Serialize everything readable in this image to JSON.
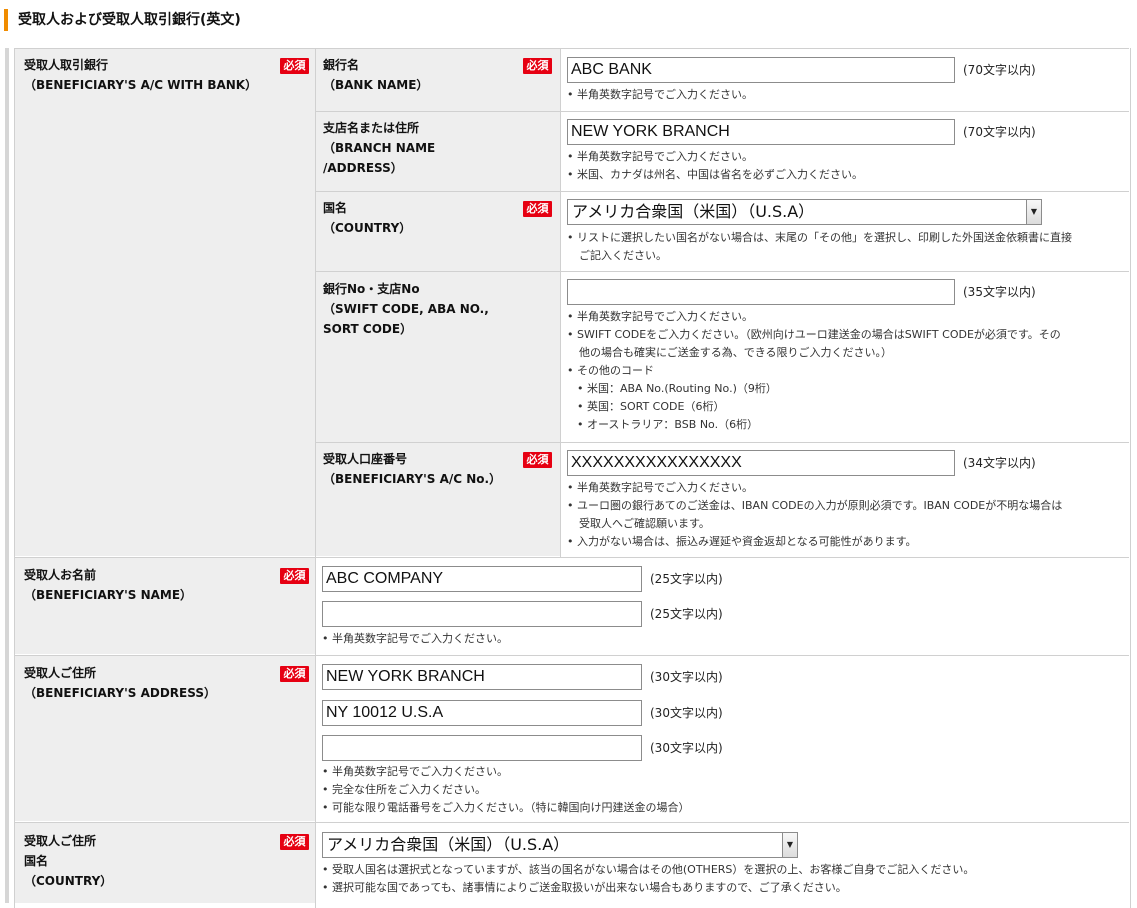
{
  "section_title": "受取人および受取人取引銀行(英文)",
  "required_label": "必須",
  "bank_group": {
    "label_ja": "受取人取引銀行",
    "label_en": "（BENEFICIARY'S A/C WITH BANK）"
  },
  "bank_name": {
    "label_ja": "銀行名",
    "label_en": "（BANK NAME）",
    "value": "ABC BANK",
    "limit": "(70文字以内)",
    "notes": [
      "• 半角英数字記号でご入力ください。"
    ]
  },
  "branch": {
    "label_ja": "支店名または住所",
    "label_en1": "（BRANCH NAME",
    "label_en2": "/ADDRESS）",
    "value": "NEW YORK BRANCH",
    "limit": "(70文字以内)",
    "notes": [
      "• 半角英数字記号でご入力ください。",
      "• 米国、カナダは州名、中国は省名を必ずご入力ください。"
    ]
  },
  "country": {
    "label_ja": "国名",
    "label_en": "（COUNTRY）",
    "selected": "アメリカ合衆国（米国）（U.S.A）",
    "notes": [
      "• リストに選択したい国名がない場合は、末尾の「その他」を選択し、印刷した外国送金依頼書に直接",
      "ご記入ください。"
    ]
  },
  "bank_no": {
    "label_ja": "銀行No・支店No",
    "label_en1": "（SWIFT CODE, ABA NO.,",
    "label_en2": "SORT CODE）",
    "value": "",
    "limit": "(35文字以内)",
    "notes": [
      "• 半角英数字記号でご入力ください。",
      "• SWIFT CODEをご入力ください。（欧州向けユーロ建送金の場合はSWIFT CODEが必須です。その",
      "他の場合も確実にご送金する為、できる限りご入力ください。）",
      "• その他のコード",
      "• 米国：ABA No.(Routing No.)（9桁）",
      "• 英国：SORT CODE（6桁）",
      "• オーストラリア：BSB No.（6桁）"
    ]
  },
  "account_no": {
    "label_ja": "受取人口座番号",
    "label_en": "（BENEFICIARY'S A/C No.）",
    "value": "XXXXXXXXXXXXXXXX",
    "limit": "(34文字以内)",
    "notes": [
      "• 半角英数字記号でご入力ください。",
      "• ユーロ圏の銀行あてのご送金は、IBAN CODEの入力が原則必須です。IBAN CODEが不明な場合は",
      "受取人へご確認願います。",
      "• 入力がない場合は、振込み遅延や資金返却となる可能性があります。"
    ]
  },
  "beneficiary_name": {
    "label_ja": "受取人お名前",
    "label_en": "（BENEFICIARY'S NAME）",
    "value1": "ABC COMPANY",
    "value2": "",
    "limit": "(25文字以内)",
    "notes": [
      "• 半角英数字記号でご入力ください。"
    ]
  },
  "beneficiary_address": {
    "label_ja": "受取人ご住所",
    "label_en": "（BENEFICIARY'S ADDRESS）",
    "value1": "NEW YORK BRANCH",
    "value2": "NY 10012 U.S.A",
    "value3": "",
    "limit": "(30文字以内)",
    "notes": [
      "• 半角英数字記号でご入力ください。",
      "• 完全な住所をご入力ください。",
      "• 可能な限り電話番号をご入力ください。（特に韓国向け円建送金の場合）"
    ]
  },
  "beneficiary_country": {
    "label_ja1": "受取人ご住所",
    "label_ja2": "国名",
    "label_en": "（COUNTRY）",
    "selected": "アメリカ合衆国（米国）（U.S.A）",
    "notes": [
      "• 受取人国名は選択式となっていますが、該当の国名がない場合はその他(OTHERS）を選択の上、お客様ご自身でご記入ください。",
      "• 選択可能な国であっても、諸事情によりご送金取扱いが出来ない場合もありますので、ご了承ください。"
    ]
  },
  "dropdown_arrow": "chevron-down-icon"
}
